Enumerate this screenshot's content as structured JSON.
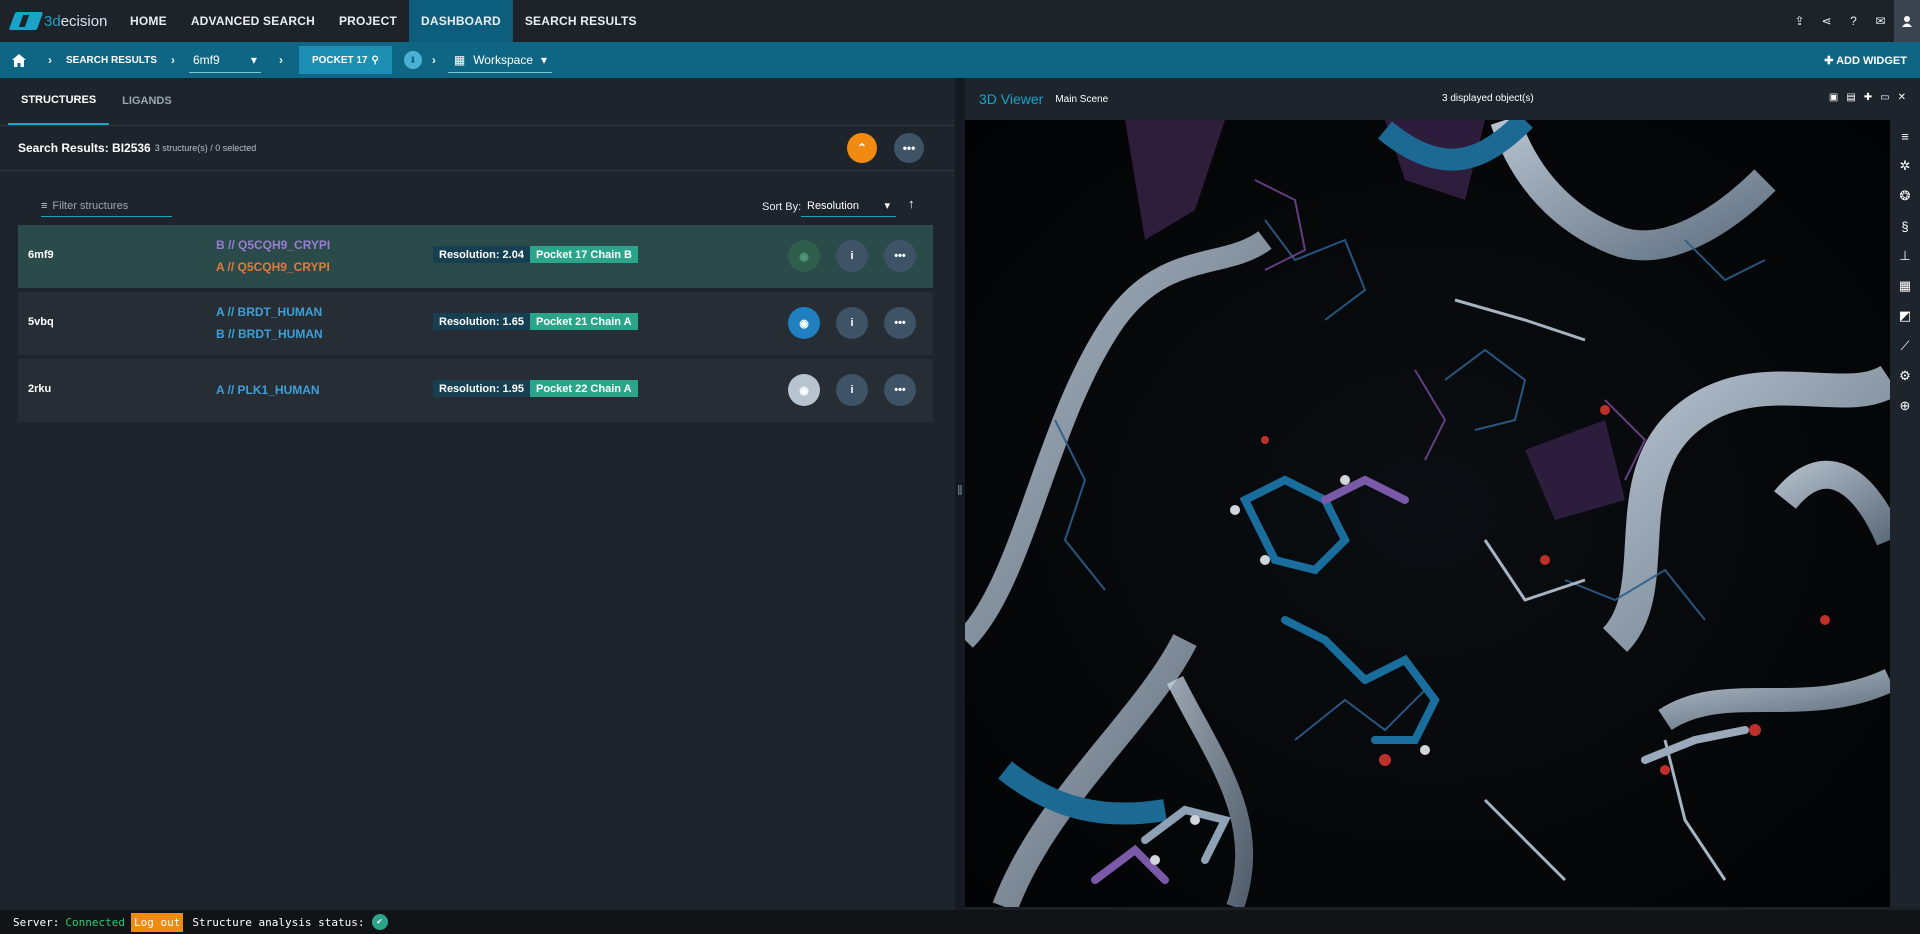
{
  "app": {
    "brand_prefix": "3d",
    "brand_suffix": "ecision"
  },
  "nav": [
    "HOME",
    "ADVANCED SEARCH",
    "PROJECT",
    "DASHBOARD",
    "SEARCH RESULTS"
  ],
  "breadcrumb": {
    "search_results": "SEARCH RESULTS",
    "structure": "6mf9",
    "pocket": "POCKET 17",
    "workspace": "Workspace",
    "add_widget": "ADD WIDGET"
  },
  "tabs": [
    "STRUCTURES",
    "LIGANDS"
  ],
  "results": {
    "title": "Search Results: BI2536",
    "subtitle": "3 structure(s) / 0 selected"
  },
  "filter": {
    "placeholder": "Filter structures"
  },
  "sort": {
    "label": "Sort By:",
    "value": "Resolution"
  },
  "rows": [
    {
      "id": "6mf9",
      "chains": [
        {
          "text": "B // Q5CQH9_CRYPI",
          "color": "#9b7bd4"
        },
        {
          "text": "A // Q5CQH9_CRYPI",
          "color": "#e07b3e"
        }
      ],
      "resolution": "Resolution: 2.04",
      "pocket": "Pocket 17 Chain B",
      "visible": false,
      "eye_color": "#2f5e4d"
    },
    {
      "id": "5vbq",
      "chains": [
        {
          "text": "A // BRDT_HUMAN",
          "color": "#3ea0d8"
        },
        {
          "text": "B // BRDT_HUMAN",
          "color": "#3ea0d8"
        }
      ],
      "resolution": "Resolution: 1.65",
      "pocket": "Pocket 21 Chain A",
      "visible": true,
      "eye_color": "#1f7fc0"
    },
    {
      "id": "2rku",
      "chains": [
        {
          "text": "A // PLK1_HUMAN",
          "color": "#3ea0d8"
        }
      ],
      "resolution": "Resolution: 1.95",
      "pocket": "Pocket 22 Chain A",
      "visible": true,
      "eye_color": "#b7c3cf"
    }
  ],
  "viewer": {
    "title": "3D Viewer",
    "scene": "Main Scene",
    "count": "3 displayed object(s)"
  },
  "status": {
    "server_label": "Server:",
    "server_state": "Connected",
    "logout": "Log out",
    "analysis": "Structure analysis status:"
  },
  "colors": {
    "accent": "#1aa3c9",
    "orange": "#f08a10",
    "green": "#2aa58a"
  }
}
